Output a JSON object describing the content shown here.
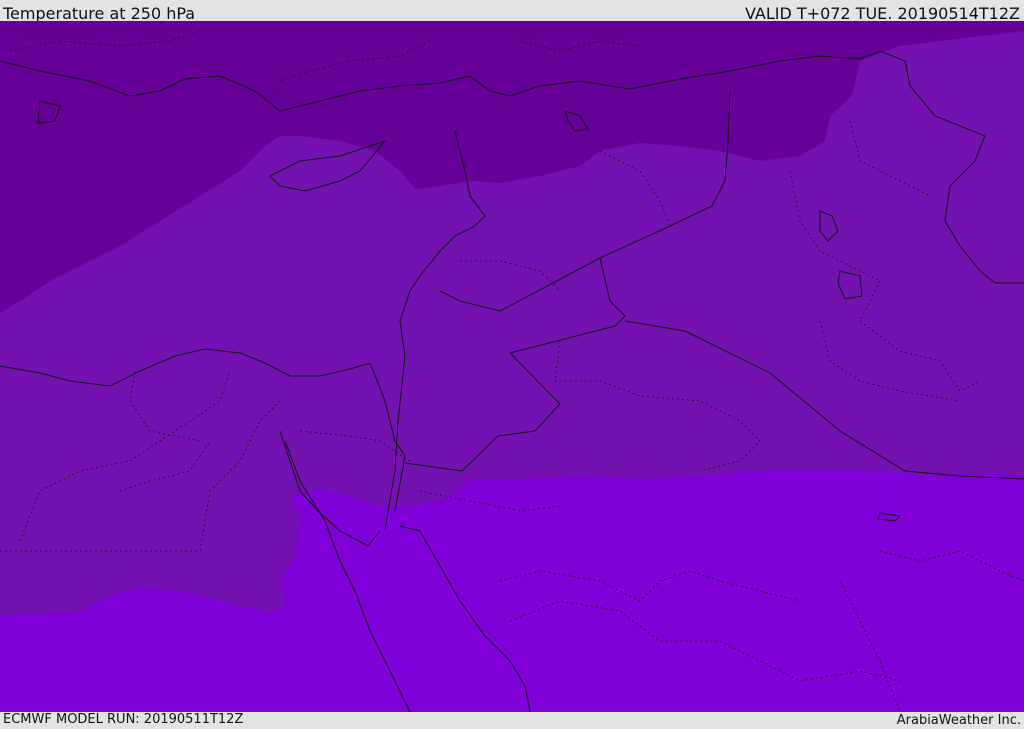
{
  "header": {
    "title": "Temperature at 250 hPa",
    "valid": "VALID T+072 TUE. 20190514T12Z"
  },
  "footer": {
    "model_run": "ECMWF MODEL RUN: 20190511T12Z",
    "credit": "ArabiaWeather Inc."
  },
  "map": {
    "colors": {
      "cold_band": "#660099",
      "mid_band": "#7412b1",
      "warm_band": "#7f00d9",
      "borders": "#111111"
    }
  }
}
